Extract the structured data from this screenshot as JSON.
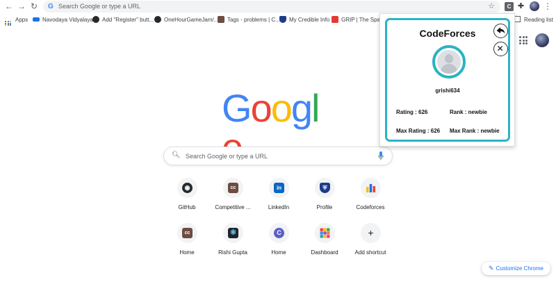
{
  "toolbar": {
    "url_placeholder": "Search Google or type a URL",
    "extension_cf_label": "C"
  },
  "bookmarks": {
    "apps_label": "Apps",
    "items": [
      {
        "label": "Navodaya Vidyalaya",
        "color": "#1a73e8"
      },
      {
        "label": "Add \"Register\" butt...",
        "color": "#24292e"
      },
      {
        "label": "OneHourGameJam/...",
        "color": "#24292e"
      },
      {
        "label": "Tags - problems | C...",
        "color": "#6d4c41"
      },
      {
        "label": "My Credible Info",
        "color": "#1e3a8a"
      },
      {
        "label": "GRIP | The Sparks ...",
        "color": "#e53935"
      }
    ],
    "reading_list_label": "Reading list"
  },
  "google_logo": {
    "letters": [
      {
        "char": "G",
        "color": "#4285f4"
      },
      {
        "char": "o",
        "color": "#ea4335"
      },
      {
        "char": "o",
        "color": "#fbbc05"
      },
      {
        "char": "g",
        "color": "#4285f4"
      },
      {
        "char": "l",
        "color": "#34a853"
      },
      {
        "char": "e",
        "color": "#ea4335"
      }
    ]
  },
  "search": {
    "placeholder": "Search Google or type a URL"
  },
  "shortcuts": [
    {
      "label": "GitHub",
      "icon": "github-icon",
      "glyph": "◉",
      "bg": "#24292e"
    },
    {
      "label": "Competitive ...",
      "icon": "codechef-icon",
      "glyph": "cc",
      "bg": "#6d4c41"
    },
    {
      "label": "LinkedIn",
      "icon": "linkedin-icon",
      "glyph": "in",
      "bg": "#0a66c2"
    },
    {
      "label": "Profile",
      "icon": "shield-icon",
      "glyph": "⛨",
      "bg": "#1e3a8a"
    },
    {
      "label": "Codeforces",
      "icon": "codeforces-icon",
      "glyph": "▮",
      "bg": "#ffffff"
    },
    {
      "label": "Home",
      "icon": "codechef-icon",
      "glyph": "cc",
      "bg": "#6d4c41"
    },
    {
      "label": "Rishi Gupta",
      "icon": "react-icon",
      "glyph": "⚛",
      "bg": "#20232a"
    },
    {
      "label": "Home",
      "icon": "credible-icon",
      "glyph": "C",
      "bg": "#5b5fc7"
    },
    {
      "label": "Dashboard",
      "icon": "dashboard-icon",
      "glyph": "▦",
      "bg": "#f4b400"
    },
    {
      "label": "Add shortcut",
      "icon": "plus-icon",
      "glyph": "+",
      "bg": "#f1f3f4"
    }
  ],
  "customize": {
    "label": "Customize Chrome"
  },
  "popup": {
    "title": "CodeForces",
    "username": "grishi634",
    "rating": "Rating : 626",
    "rank": "Rank : newbie",
    "max_rating": "Max Rating : 626",
    "max_rank": "Max Rank : newbie",
    "accent": "#2bb3c2"
  }
}
